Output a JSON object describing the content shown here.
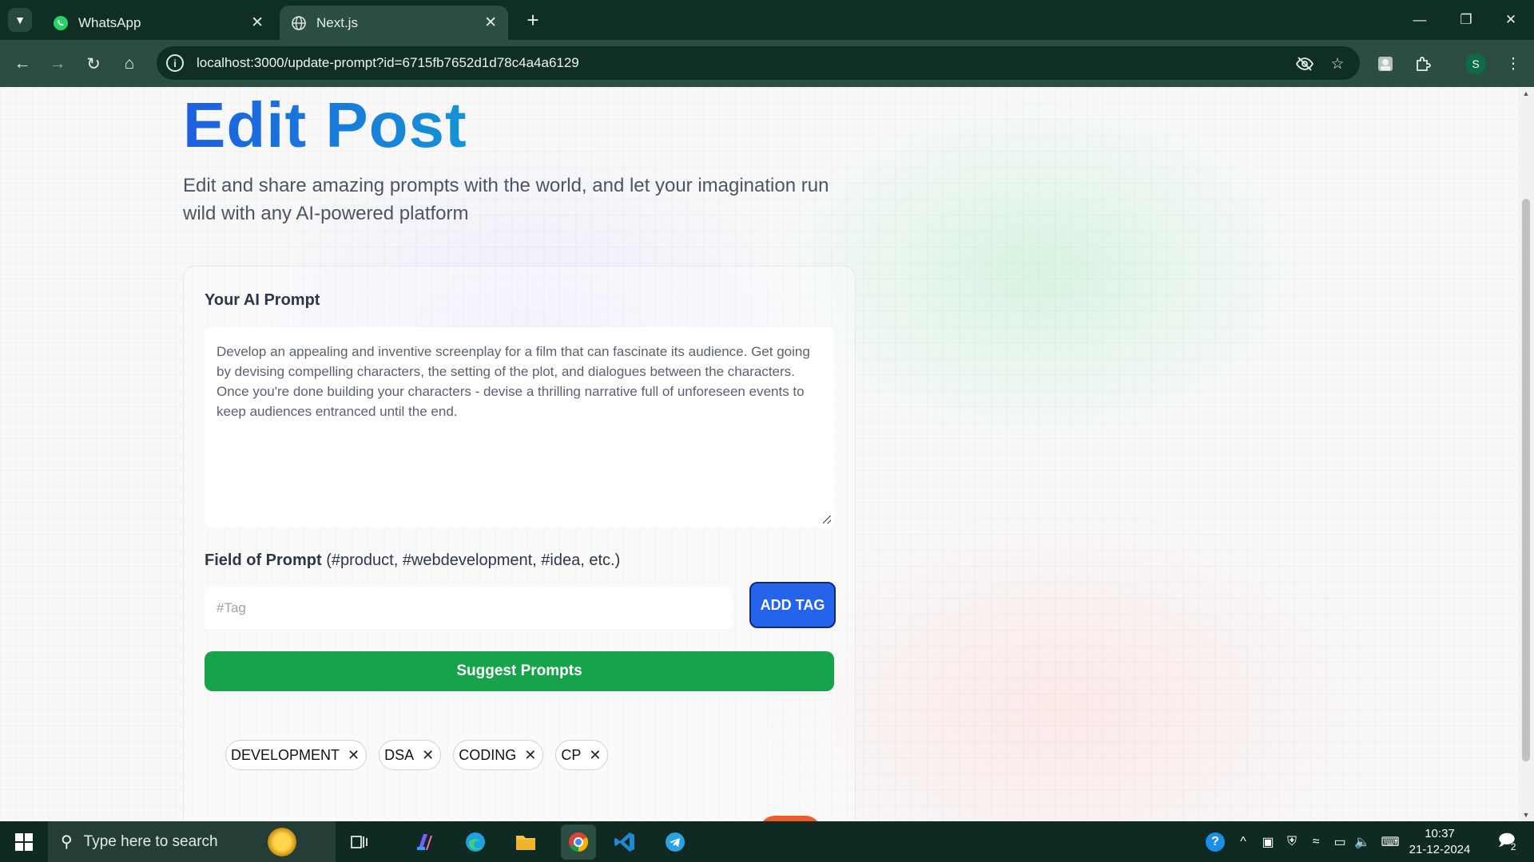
{
  "browser": {
    "tabs": [
      {
        "title": "WhatsApp",
        "icon": "whatsapp-icon",
        "active": false
      },
      {
        "title": "Next.js",
        "icon": "globe-icon",
        "active": true
      }
    ],
    "url": "localhost:3000/update-prompt?id=6715fb7652d1d78c4a4a6129",
    "profile_initial": "S"
  },
  "page": {
    "heading": "Edit Post",
    "description": "Edit and share amazing prompts with the world, and let your imagination run wild with any AI-powered platform",
    "form": {
      "prompt_label": "Your AI Prompt",
      "prompt_value": "Develop an appealing and inventive screenplay for a film that can fascinate its audience. Get going by devising compelling characters, the setting of the plot, and dialogues between the characters. Once you're done building your characters - devise a thrilling narrative full of unforeseen events to keep audiences entranced until the end.",
      "field_label": "Field of Prompt",
      "field_hint": "(#product, #webdevelopment, #idea, etc.)",
      "tag_placeholder": "#Tag",
      "add_tag_label": "ADD TAG",
      "suggest_label": "Suggest Prompts",
      "tags": [
        "DEVELOPMENT",
        "DSA",
        "CODING",
        "CP"
      ]
    }
  },
  "taskbar": {
    "search_placeholder": "Type here to search",
    "time": "10:37",
    "date": "21-12-2024",
    "notification_count": "2"
  },
  "colors": {
    "heading_gradient_start": "#1d5fe0",
    "heading_gradient_end": "#1593d6",
    "add_tag_button": "#2563eb",
    "suggest_button": "#16a34a",
    "browser_frame": "#0f2e24"
  }
}
